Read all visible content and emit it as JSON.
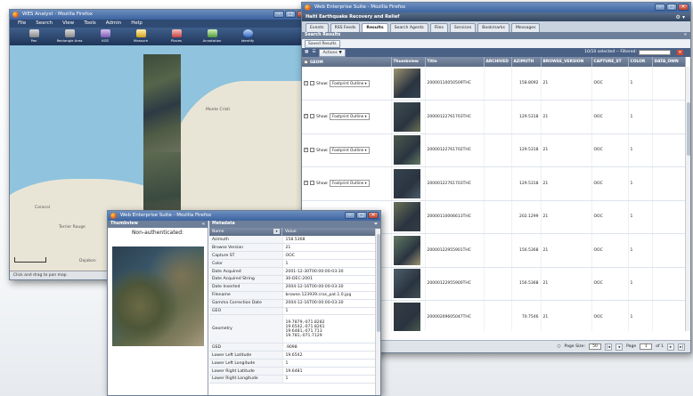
{
  "w1": {
    "title": "WES Analyst - Mozilla Firefox",
    "menu": [
      "File",
      "Search",
      "View",
      "Tools",
      "Admin",
      "Help"
    ],
    "tools": [
      "Pan",
      "Rectangle Area",
      "KGS",
      "Measure",
      "Places",
      "Annotation",
      "Identify"
    ],
    "map_labels": [
      "Monte Cristi",
      "Caracol",
      "Terrier Rouge",
      "Dajabon"
    ],
    "status": "Click and drag to pan map"
  },
  "w2": {
    "title": "Web Enterprise Suite - Mozilla Firefox",
    "header": "Haiti Earthquake Recovery and Relief",
    "tabs": [
      "Events",
      "RSS Feeds",
      "Results",
      "Search Agents",
      "Files",
      "Services",
      "Bookmarks",
      "Messages"
    ],
    "section": "Search Results",
    "save_label": "Saved Results",
    "actions_label": "Actions ▼",
    "selected": "10/10 selected --",
    "filtered_label": "Filtered:",
    "columns": [
      "GEOM",
      "Thumbview",
      "Title",
      "ARCHIVED",
      "AZIMUTH",
      "BROWSE_VERSION",
      "CAPTURE_ST",
      "COLOR",
      "DATA_OWN"
    ],
    "show_label": "Show:",
    "footprint_label": "Footprint Outline ▾",
    "rows": [
      {
        "checked": true,
        "title": "20000110050509THC",
        "azimuth": "158.8092",
        "browse": "21",
        "capture": "OOC",
        "color": "1"
      },
      {
        "checked": true,
        "title": "20000122761703THC",
        "azimuth": "129.5318",
        "browse": "21",
        "capture": "OOC",
        "color": "1"
      },
      {
        "checked": true,
        "title": "20000122761702THC",
        "azimuth": "129.5318",
        "browse": "21",
        "capture": "OOC",
        "color": "1"
      },
      {
        "checked": true,
        "title": "20000122761703THC",
        "azimuth": "129.5318",
        "browse": "21",
        "capture": "OOC",
        "color": "1"
      },
      {
        "checked": false,
        "title": "20000110006613THC",
        "azimuth": "202.1299",
        "browse": "21",
        "capture": "OOC",
        "color": "1"
      },
      {
        "checked": false,
        "title": "20000122955901THC",
        "azimuth": "156.5368",
        "browse": "21",
        "capture": "OOC",
        "color": "1"
      },
      {
        "checked": false,
        "title": "20000122955900THC",
        "azimuth": "156.5368",
        "browse": "21",
        "capture": "OOC",
        "color": "1"
      },
      {
        "checked": false,
        "title": "20000209605047THC",
        "azimuth": "70.7546",
        "browse": "21",
        "capture": "OOC",
        "color": "1"
      }
    ],
    "pager": {
      "size_label": "Page Size:",
      "size": "50",
      "page_label": "Page",
      "page": "1",
      "of": "of 1"
    }
  },
  "w3": {
    "title": "Web Enterprise Suite - Mozilla Firefox",
    "thumb_header": "Thumbview",
    "nonauth": "Non-authenticated:",
    "meta_header": "Metadata",
    "col_name": "Name",
    "col_value": "Value",
    "rows": [
      [
        "Azimuth",
        "158.5368"
      ],
      [
        "Browse Version",
        "21"
      ],
      [
        "Capture ST",
        "OOC"
      ],
      [
        "Color",
        "1"
      ],
      [
        "Date Acquired",
        "2001-12-30T00:00:00-03:30"
      ],
      [
        "Date Acquired String",
        "30-DEC-2001"
      ],
      [
        "Date Inserted",
        "2004-12-16T00:00:00-03:30"
      ],
      [
        "Filename",
        "browse.123939.cras_pat.1.0.jpg"
      ],
      [
        "Gamma Correction Date",
        "2004-12-16T00:00:00-03:30"
      ],
      [
        "GEO",
        "1"
      ]
    ],
    "geometry_label": "Geometry",
    "geometry_lines": [
      "19.7879,-071.8282",
      "19.6542,-071.8261",
      "19.6481,-071.713",
      "19.781,-071.7129"
    ],
    "rows2": [
      [
        "GSD",
        ".9098"
      ],
      [
        "Lower Left Latitude",
        "19.6542"
      ],
      [
        "Lower Left Longitude",
        "1"
      ],
      [
        "Lower Right Latitude",
        "19.6481"
      ],
      [
        "Lower Right Longitude",
        "1"
      ]
    ]
  }
}
